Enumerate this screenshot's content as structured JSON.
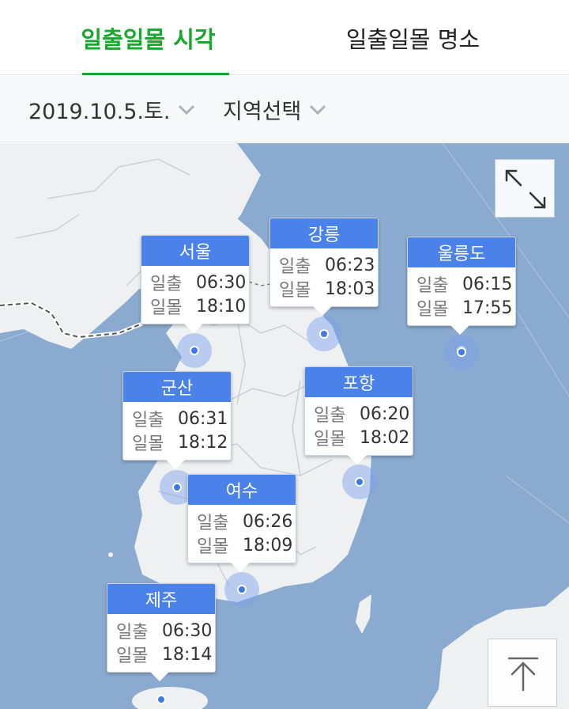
{
  "tabs": [
    {
      "label": "일출일몰 시각",
      "active": true
    },
    {
      "label": "일출일몰 명소",
      "active": false
    }
  ],
  "filters": {
    "date": "2019.10.5.토.",
    "region": "지역선택"
  },
  "labels": {
    "sunrise": "일출",
    "sunset": "일몰"
  },
  "locations": [
    {
      "name": "서울",
      "sunrise": "06:30",
      "sunset": "18:10"
    },
    {
      "name": "강릉",
      "sunrise": "06:23",
      "sunset": "18:03"
    },
    {
      "name": "울릉도",
      "sunrise": "06:15",
      "sunset": "17:55"
    },
    {
      "name": "군산",
      "sunrise": "06:31",
      "sunset": "18:12"
    },
    {
      "name": "포항",
      "sunrise": "06:20",
      "sunset": "18:02"
    },
    {
      "name": "여수",
      "sunrise": "06:26",
      "sunset": "18:09"
    },
    {
      "name": "제주",
      "sunrise": "06:30",
      "sunset": "18:14"
    }
  ],
  "colors": {
    "accent": "#16a82a",
    "popup_header": "#4a82ea",
    "sea": "#8aabcf",
    "land": "#eef0f2"
  },
  "icons": {
    "expand": "expand-diagonal-icon",
    "scroll_top": "scroll-to-top-icon",
    "dropdown": "chevron-down-icon"
  }
}
